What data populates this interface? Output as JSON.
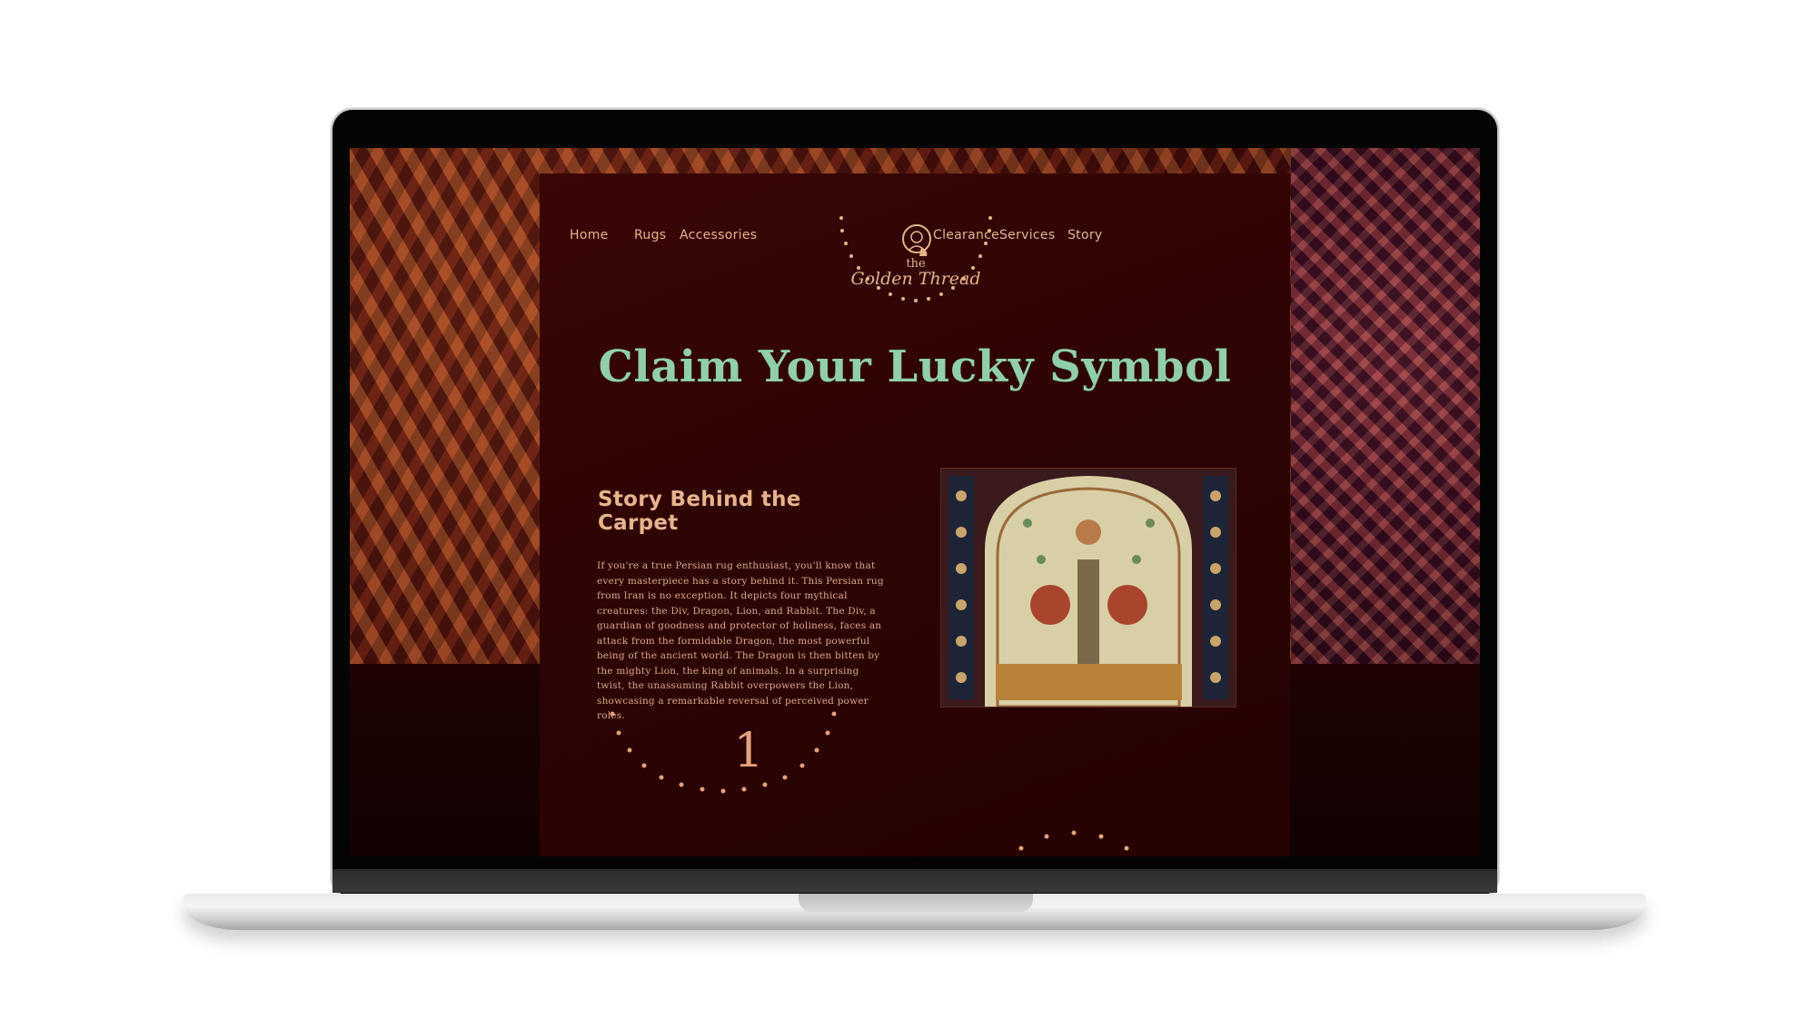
{
  "nav": {
    "left": [
      "Home",
      "Rugs",
      "Accessories"
    ],
    "right": [
      "Clearance",
      "Services",
      "Story"
    ]
  },
  "logo": {
    "the": "the",
    "name": "Golden Thread"
  },
  "hero": {
    "title": "Claim Your Lucky Symbol"
  },
  "story": {
    "heading": "Story Behind the Carpet",
    "body": "If you're a true Persian rug enthusiast, you'll know that every masterpiece has a story behind it. This Persian rug from Iran is no exception. It depicts four mythical creatures: the Div, Dragon, Lion, and Rabbit. The Div, a guardian of goodness and protector of holiness, faces an attack from the formidable Dragon, the most powerful being of the ancient world. The Dragon is then bitten by the mighty Lion, the king of animals. In a surprising twist, the unassuming Rabbit overpowers the Lion, showcasing a remarkable reversal of perceived power roles.",
    "step_number": "1"
  },
  "colors": {
    "accent_green": "#8fd0a8",
    "accent_gold": "#e6b389",
    "panel_bg": "#340505"
  },
  "icons": {
    "logo": "woman-portrait-icon"
  }
}
